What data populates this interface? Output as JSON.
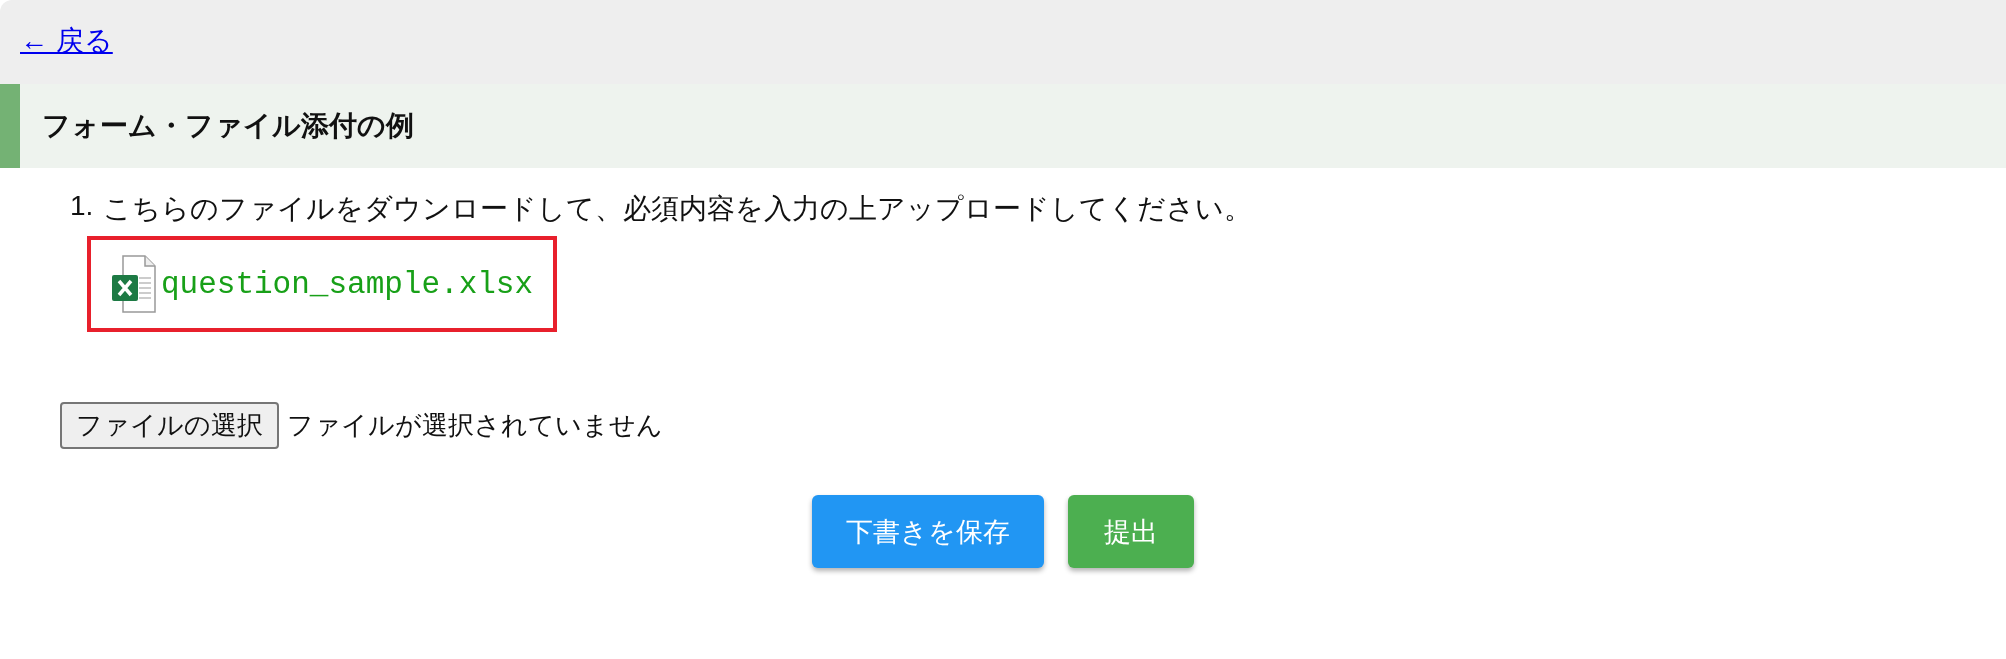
{
  "back_link": {
    "text": "← 戻る"
  },
  "section_title": "フォーム・ファイル添付の例",
  "items": [
    {
      "number": "1.",
      "text": "こちらのファイルをダウンロードして、必須内容を入力の上アップロードしてください。",
      "attachment": {
        "file_name": "question_sample.xlsx",
        "highlighted": true
      }
    }
  ],
  "file_input": {
    "button": "ファイルの選択",
    "status": "ファイルが選択されていません"
  },
  "actions": [
    {
      "label": "下書きを保存",
      "kind": "draft"
    },
    {
      "label": "提出",
      "kind": "submit"
    }
  ]
}
